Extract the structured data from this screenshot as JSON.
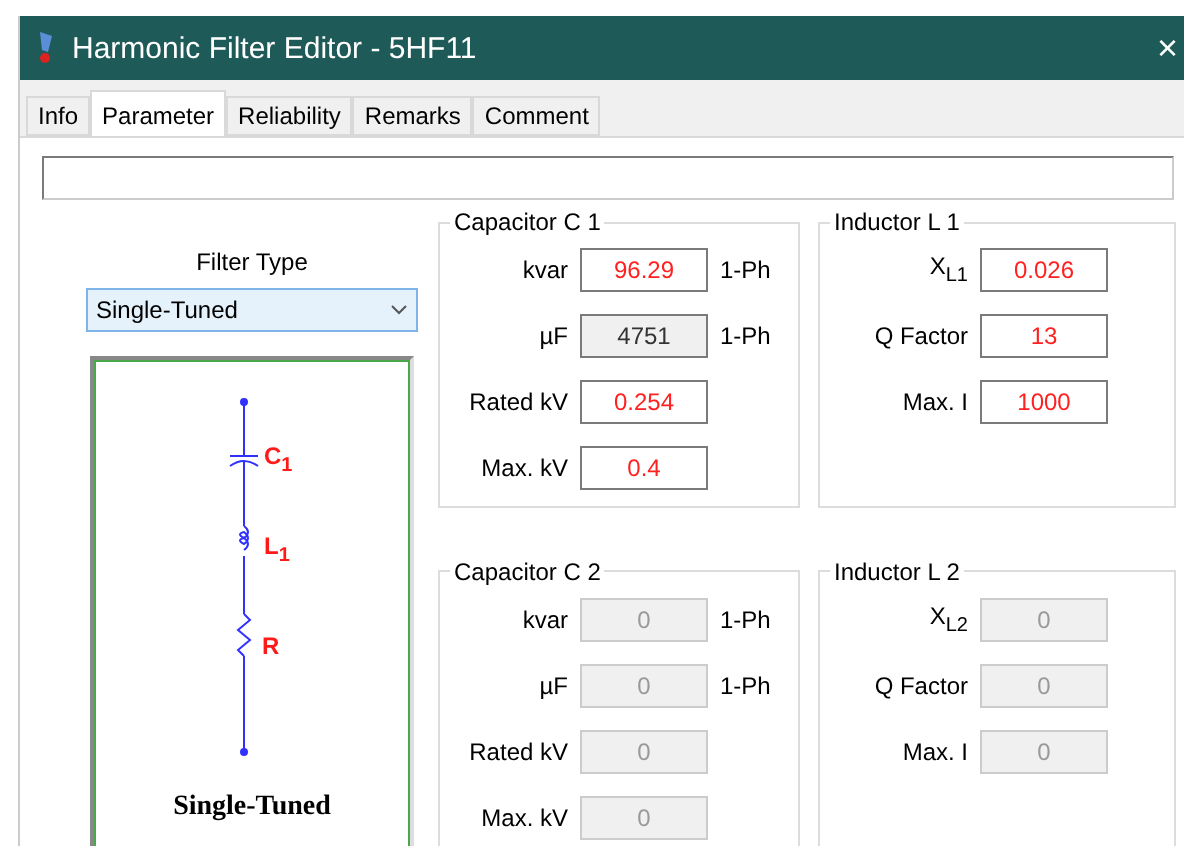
{
  "window": {
    "title": "Harmonic Filter Editor - 5HF11",
    "close": "×"
  },
  "tabs": [
    {
      "label": "Info",
      "selected": false
    },
    {
      "label": "Parameter",
      "selected": true
    },
    {
      "label": "Reliability",
      "selected": false
    },
    {
      "label": "Remarks",
      "selected": false
    },
    {
      "label": "Comment",
      "selected": false
    }
  ],
  "filter_type": {
    "label": "Filter Type",
    "value": "Single-Tuned"
  },
  "diagram": {
    "labels": [
      "C$_{1}$",
      "L$_{1}$",
      "R"
    ],
    "caption": "Single-Tuned"
  },
  "groups": [
    {
      "title": "Capacitor C 1",
      "fields": [
        {
          "label": "kvar",
          "value": "96.29",
          "unit": "1-Ph",
          "readonly": false,
          "disabled": false
        },
        {
          "label": "µF",
          "value": "4751",
          "unit": "1-Ph",
          "readonly": true,
          "disabled": false
        },
        {
          "label": "Rated kV",
          "value": "0.254",
          "readonly": false,
          "disabled": false
        },
        {
          "label": "Max. kV",
          "value": "0.4",
          "readonly": false,
          "disabled": false
        }
      ]
    },
    {
      "title": "Inductor L 1",
      "fields": [
        {
          "label": "X$_{L1}$",
          "value": "0.026",
          "readonly": false,
          "disabled": false
        },
        {
          "label": "Q Factor",
          "value": "13",
          "readonly": false,
          "disabled": false
        },
        {
          "label": "Max. I",
          "value": "1000",
          "readonly": false,
          "disabled": false
        }
      ]
    },
    {
      "title": "Capacitor C 2",
      "fields": [
        {
          "label": "kvar",
          "value": "0",
          "unit": "1-Ph",
          "readonly": false,
          "disabled": true
        },
        {
          "label": "µF",
          "value": "0",
          "unit": "1-Ph",
          "readonly": false,
          "disabled": true
        },
        {
          "label": "Rated kV",
          "value": "0",
          "readonly": false,
          "disabled": true
        },
        {
          "label": "Max. kV",
          "value": "0",
          "readonly": false,
          "disabled": true
        }
      ]
    },
    {
      "title": "Inductor L 2",
      "fields": [
        {
          "label": "X$_{L2}$",
          "value": "0",
          "readonly": false,
          "disabled": true
        },
        {
          "label": "Q Factor",
          "value": "0",
          "readonly": false,
          "disabled": true
        },
        {
          "label": "Max. I",
          "value": "0",
          "readonly": false,
          "disabled": true
        }
      ]
    }
  ]
}
